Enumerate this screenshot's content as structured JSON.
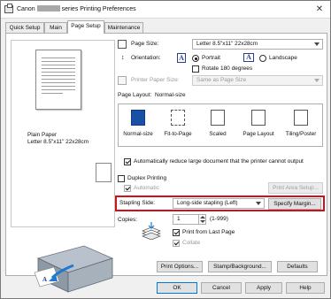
{
  "window": {
    "title_prefix": "Canon",
    "title_suffix": "series Printing Preferences"
  },
  "tabs": [
    "Quick Setup",
    "Main",
    "Page Setup",
    "Maintenance"
  ],
  "active_tab": "Page Setup",
  "preview": {
    "media_label": "Plain Paper\nLetter 8.5\"x11\" 22x28cm"
  },
  "page_size": {
    "label": "Page Size:",
    "value": "Letter 8.5\"x11\" 22x28cm"
  },
  "orientation": {
    "label": "Orientation:",
    "portrait": "Portrait",
    "landscape": "Landscape",
    "selected": "Portrait",
    "rotate_label": "Rotate 180 degrees",
    "rotate_checked": false
  },
  "printer_paper_size": {
    "label": "Printer Paper Size:",
    "value": "Same as Page Size"
  },
  "page_layout": {
    "label": "Page Layout:",
    "current": "Normal-size",
    "options": [
      "Normal-size",
      "Fit-to-Page",
      "Scaled",
      "Page Layout",
      "Tiling/Poster"
    ],
    "selected_index": 0
  },
  "auto_reduce": {
    "label": "Automatically reduce large document that the printer cannot output",
    "checked": true
  },
  "duplex": {
    "label": "Duplex Printing",
    "checked": false,
    "automatic_label": "Automatic",
    "automatic_checked": true,
    "print_area_button": "Print Area Setup..."
  },
  "stapling": {
    "label": "Stapling Side:",
    "value": "Long-side stapling (Left)",
    "specify_margin_button": "Specify Margin..."
  },
  "copies": {
    "label": "Copies:",
    "value": "1",
    "range": "(1-999)",
    "print_from_last_label": "Print from Last Page",
    "print_from_last_checked": true,
    "collate_label": "Collate",
    "collate_checked": true
  },
  "bottom_buttons": [
    "Print Options...",
    "Stamp/Background...",
    "Defaults"
  ],
  "dialog_buttons": [
    "OK",
    "Cancel",
    "Apply",
    "Help"
  ],
  "colors": {
    "highlight": "#d0101a",
    "selected_layout": "#1a4fa6"
  }
}
